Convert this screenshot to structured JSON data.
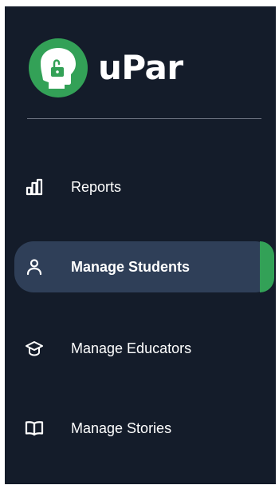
{
  "brand": {
    "name": "uPar",
    "logo_icon": "head-with-padlock-icon",
    "logo_color": "#33a157"
  },
  "sidebar": {
    "background": "#141c2a",
    "active_background": "#2f3f58",
    "accent": "#33a157",
    "items": [
      {
        "label": "Reports",
        "icon": "bar-chart-icon",
        "active": false
      },
      {
        "label": "Manage Students",
        "icon": "user-icon",
        "active": true
      },
      {
        "label": "Manage Educators",
        "icon": "graduation-cap-icon",
        "active": false
      },
      {
        "label": "Manage Stories",
        "icon": "open-book-icon",
        "active": false
      }
    ]
  }
}
